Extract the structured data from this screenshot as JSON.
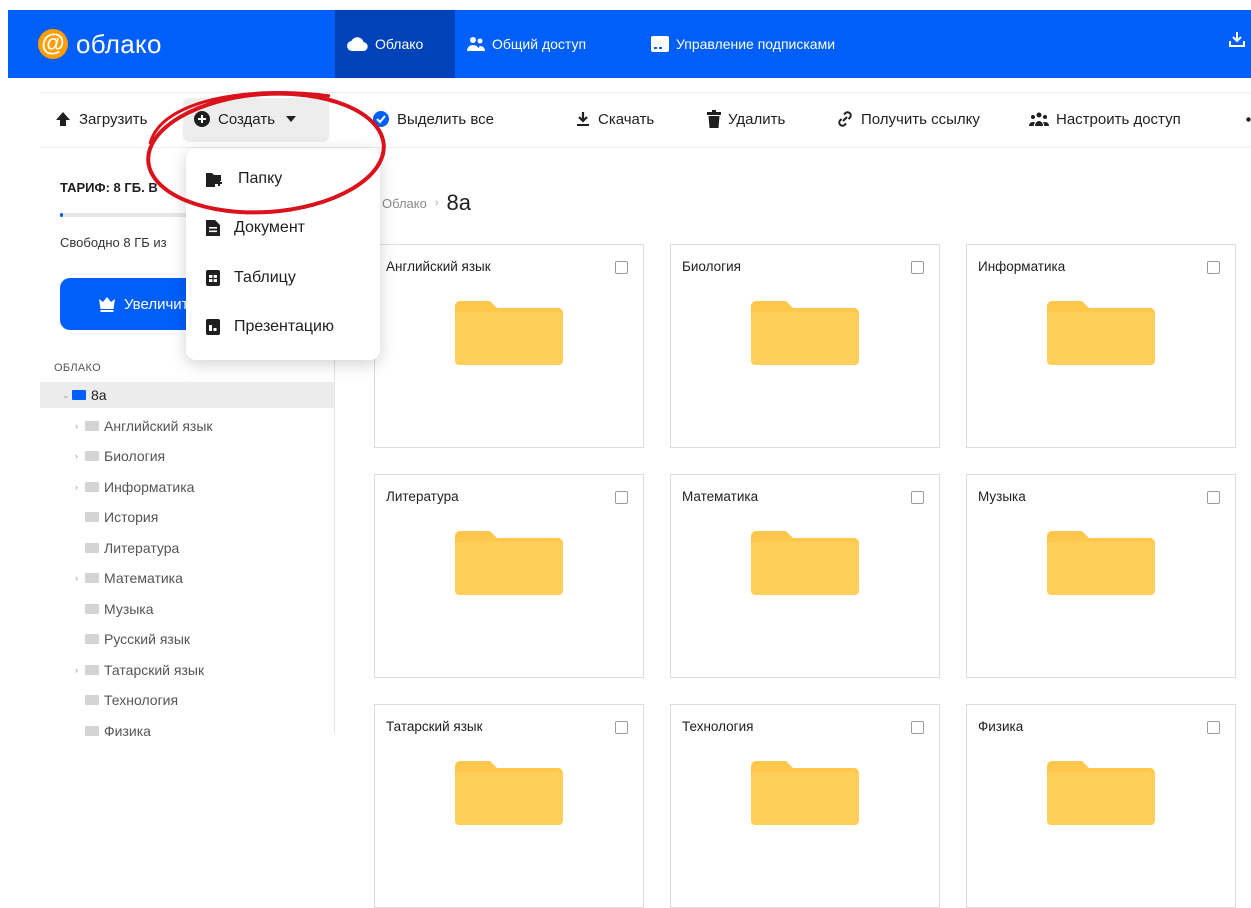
{
  "brand": {
    "logo_symbol": "@",
    "name": "облако",
    "brand_color": "#005ff9",
    "logo_accent": "#ff9e00"
  },
  "nav": [
    {
      "label": "Облако",
      "icon": "cloud-icon",
      "active": true
    },
    {
      "label": "Общий доступ",
      "icon": "users-icon",
      "active": false
    },
    {
      "label": "Управление подписками",
      "icon": "subscription-icon",
      "active": false
    }
  ],
  "toolbar": {
    "upload": "Загрузить",
    "create": "Создать",
    "select_all": "Выделить все",
    "download": "Скачать",
    "delete": "Удалить",
    "get_link": "Получить ссылку",
    "configure_access": "Настроить доступ"
  },
  "create_menu": {
    "items": [
      {
        "label": "Папку",
        "icon": "new-folder-icon"
      },
      {
        "label": "Документ",
        "icon": "document-icon"
      },
      {
        "label": "Таблицу",
        "icon": "table-icon"
      },
      {
        "label": "Презентацию",
        "icon": "presentation-icon"
      }
    ],
    "highlight_color": "#d9121b"
  },
  "sidebar": {
    "tariff": "ТАРИФ: 8 ГБ. В",
    "storage_used_fraction": 0.01,
    "free_space": "Свободно 8 ГБ из",
    "upgrade_button": "Увеличить",
    "section_label": "ОБЛАКО",
    "tree": [
      {
        "label": "8а",
        "root": true,
        "expandable": true
      },
      {
        "label": "Английский язык",
        "expandable": true
      },
      {
        "label": "Биология",
        "expandable": true
      },
      {
        "label": "Информатика",
        "expandable": true
      },
      {
        "label": "История",
        "expandable": false
      },
      {
        "label": "Литература",
        "expandable": false
      },
      {
        "label": "Математика",
        "expandable": true
      },
      {
        "label": "Музыка",
        "expandable": false
      },
      {
        "label": "Русский язык",
        "expandable": false
      },
      {
        "label": "Татарский язык",
        "expandable": true
      },
      {
        "label": "Технология",
        "expandable": false
      },
      {
        "label": "Физика",
        "expandable": false
      }
    ]
  },
  "breadcrumb": {
    "root": "Облако",
    "current": "8а"
  },
  "folders": [
    {
      "name": "Английский язык"
    },
    {
      "name": "Биология"
    },
    {
      "name": "Информатика"
    },
    {
      "name": "Литература"
    },
    {
      "name": "Математика"
    },
    {
      "name": "Музыка"
    },
    {
      "name": "Татарский язык"
    },
    {
      "name": "Технология"
    },
    {
      "name": "Физика"
    }
  ]
}
